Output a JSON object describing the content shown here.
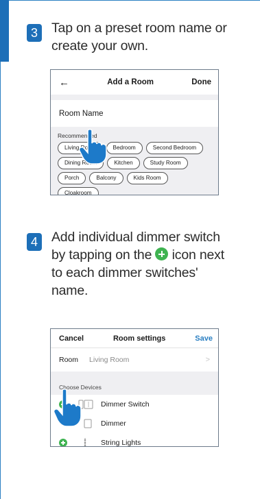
{
  "colors": {
    "accent": "#1d6fb8",
    "add_green": "#3fb351",
    "save_blue": "#2a7fc2"
  },
  "step3": {
    "number": "3",
    "text": "Tap on a preset room name or create your own.",
    "screen": {
      "back_icon": "back-arrow-icon",
      "title": "Add a Room",
      "done": "Done",
      "room_name_label": "Room Name",
      "recommended_label": "Recommended",
      "chips": [
        "Living Room",
        "Bedroom",
        "Second Bedroom",
        "Dining Room",
        "Kitchen",
        "Study Room",
        "Porch",
        "Balcony",
        "Kids Room",
        "Cloakroom"
      ]
    }
  },
  "step4": {
    "number": "4",
    "text_before": "Add individual dimmer switch by tapping on the",
    "text_after": "icon next to each dimmer switches' name.",
    "screen": {
      "cancel": "Cancel",
      "title": "Room settings",
      "save": "Save",
      "room_label": "Room",
      "room_value": "Living Room",
      "choose_label": "Choose Devices",
      "devices": [
        "Dimmer Switch",
        "Dimmer",
        "String Lights"
      ]
    }
  }
}
